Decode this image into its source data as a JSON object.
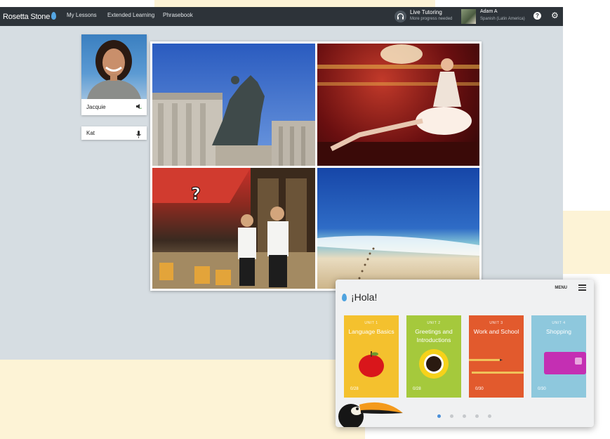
{
  "topbar": {
    "logo": "Rosetta Stone",
    "nav": [
      "My Lessons",
      "Extended Learning",
      "Phrasebook"
    ],
    "tutoring_title": "Live Tutoring",
    "tutoring_sub": "More progress needed",
    "user_name": "Adam A",
    "user_course": "Spanish (Latin America)"
  },
  "speakers": {
    "primary": "Jacquie",
    "secondary": "Kat"
  },
  "grid": {
    "question_mark": "?"
  },
  "mobile": {
    "menu_label": "MENU",
    "greeting": "¡Hola!",
    "units": [
      {
        "number": "UNIT 1",
        "title": "Language Basics",
        "progress": "0/28"
      },
      {
        "number": "UNIT 2",
        "title": "Greetings and Introductions",
        "progress": "0/28"
      },
      {
        "number": "UNIT 3",
        "title": "Work and School",
        "progress": "0/30"
      },
      {
        "number": "UNIT 4",
        "title": "Shopping",
        "progress": "0/30"
      }
    ],
    "active_page": 1,
    "page_count": 5
  },
  "colors": {
    "topbar": "#2d3339",
    "unit1": "#f4c12e",
    "unit2": "#a5c93c",
    "unit3": "#e25a2d",
    "unit4": "#8ec8dd",
    "active_dot": "#4a8fd8"
  }
}
